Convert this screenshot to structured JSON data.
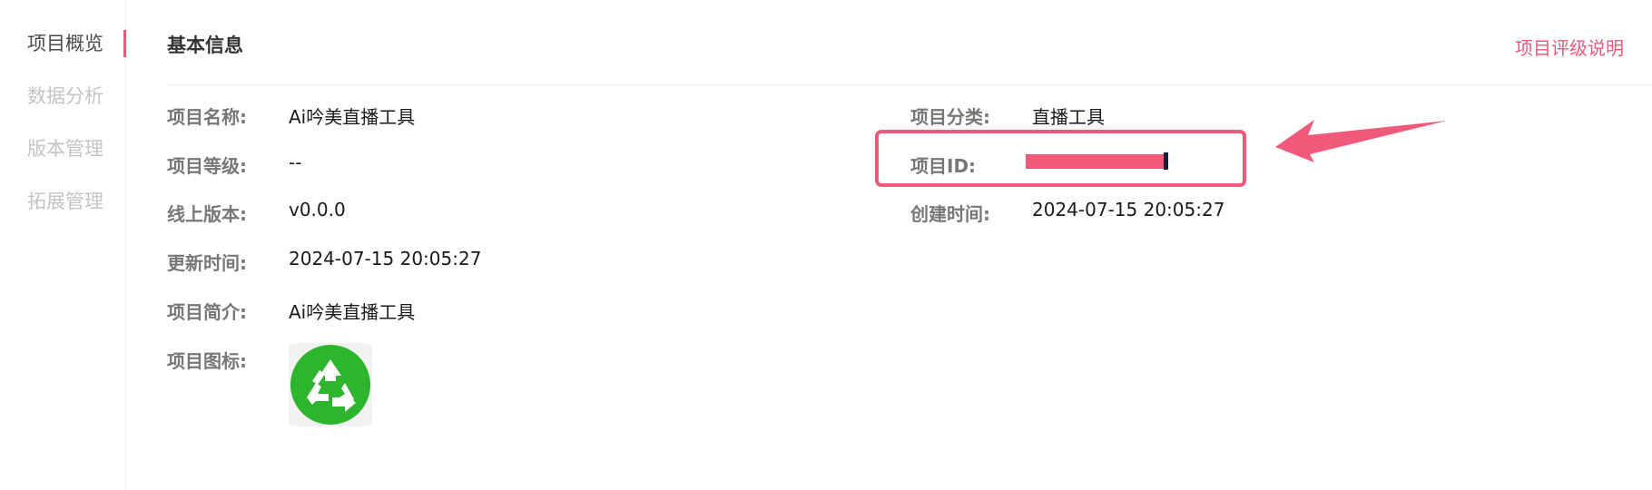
{
  "sidebar": {
    "items": [
      {
        "label": "项目概览"
      },
      {
        "label": "数据分析"
      },
      {
        "label": "版本管理"
      },
      {
        "label": "拓展管理"
      }
    ]
  },
  "header": {
    "title": "基本信息",
    "rating_link": "项目评级说明"
  },
  "info": {
    "name": {
      "label": "项目名称:",
      "value": "Ai吟美直播工具"
    },
    "level": {
      "label": "项目等级:",
      "value": "--"
    },
    "online_version": {
      "label": "线上版本:",
      "value": "v0.0.0"
    },
    "updated": {
      "label": "更新时间:",
      "value": "2024-07-15 20:05:27"
    },
    "intro": {
      "label": "项目简介:",
      "value": "Ai吟美直播工具"
    },
    "icon": {
      "label": "项目图标:"
    },
    "category": {
      "label": "项目分类:",
      "value": "直播工具"
    },
    "project_id": {
      "label": "项目ID:"
    },
    "created": {
      "label": "创建时间:",
      "value": "2024-07-15 20:05:27"
    }
  },
  "colors": {
    "accent": "#f0597a",
    "icon_green": "#2db52d"
  },
  "icons": {
    "project_icon": "recycle-icon",
    "annotation": "arrow-icon"
  }
}
